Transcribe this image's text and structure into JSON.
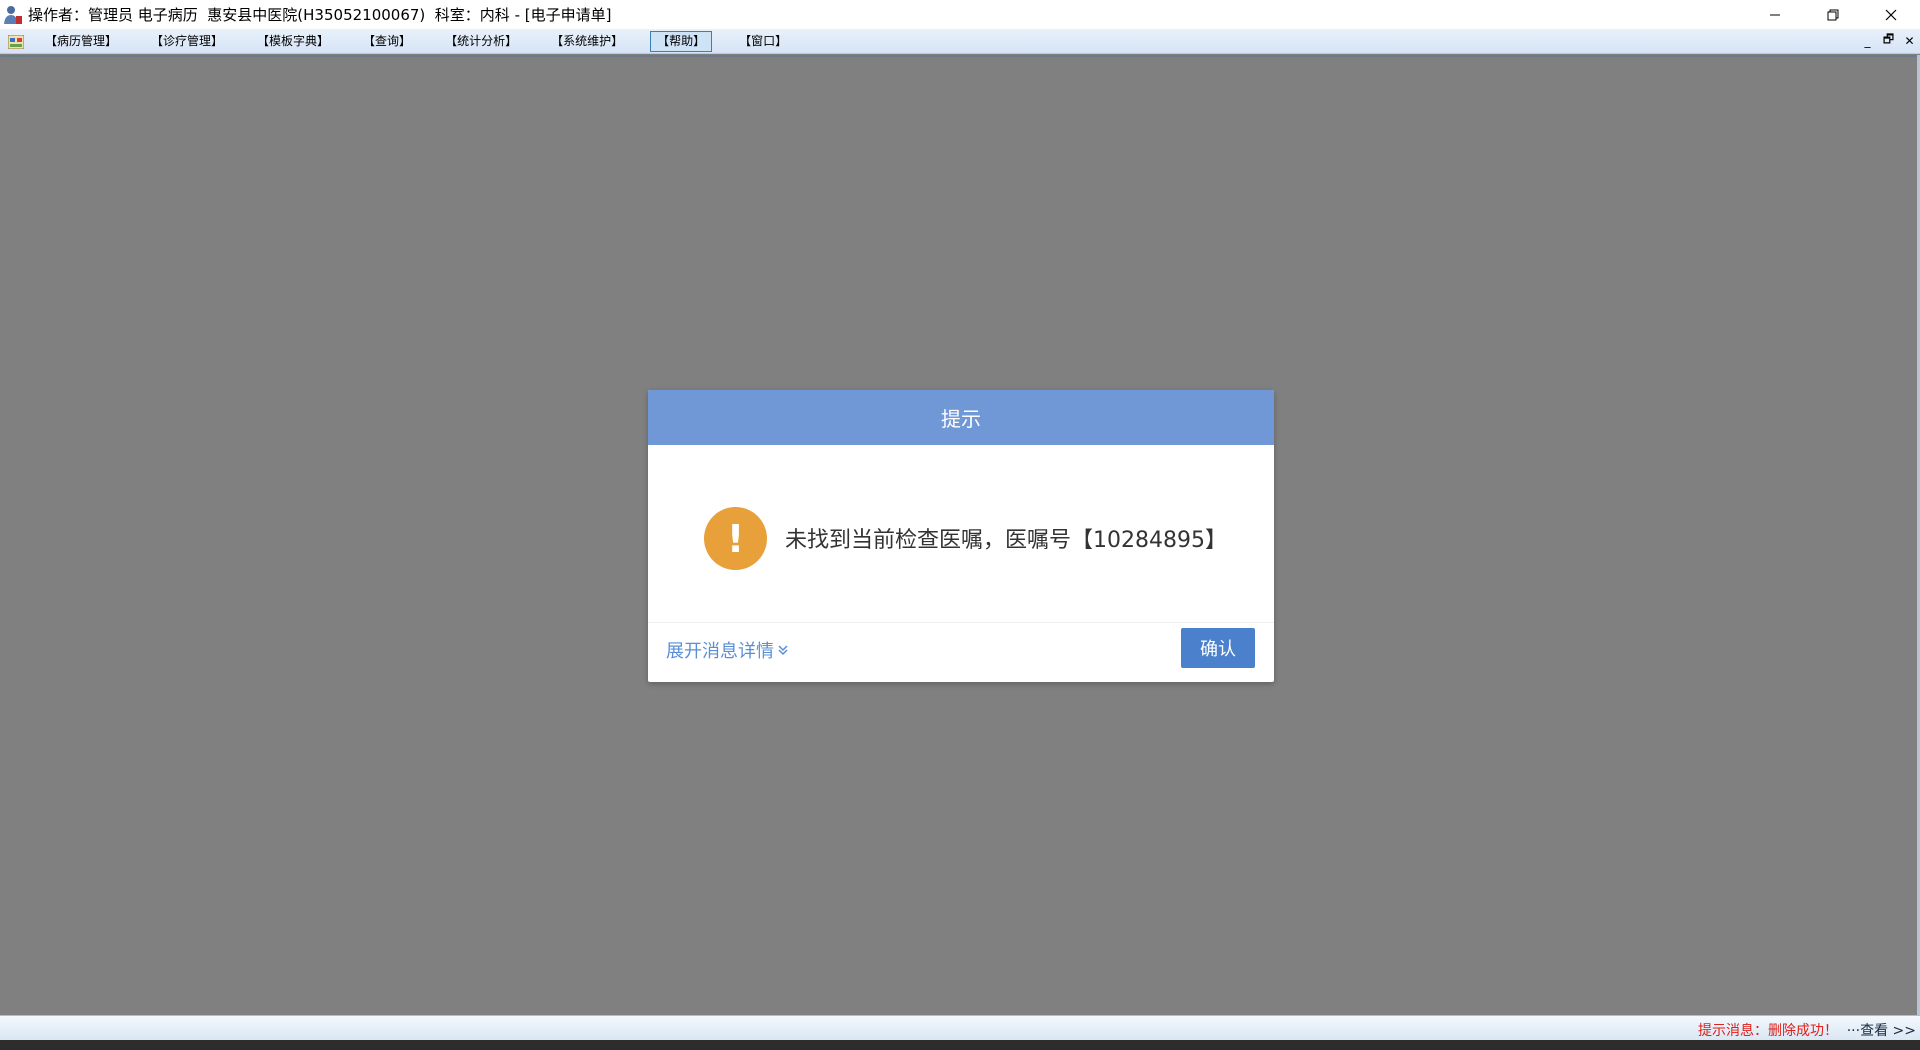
{
  "window": {
    "title": "操作者：管理员 电子病历  惠安县中医院(H35052100067)  科室：内科 - [电子申请单]",
    "icons": {
      "app": "doctor-app-icon",
      "minimize": "minimize-icon",
      "restore": "restore-icon",
      "close": "close-icon"
    }
  },
  "menu": {
    "items": [
      {
        "label": "【病历管理】"
      },
      {
        "label": "【诊疗管理】"
      },
      {
        "label": "【模板字典】"
      },
      {
        "label": "【查询】"
      },
      {
        "label": "【统计分析】"
      },
      {
        "label": "【系统维护】"
      },
      {
        "label": "【帮助】"
      },
      {
        "label": "【窗口】"
      }
    ],
    "active_index": 6,
    "mdi_controls": {
      "minimize": "_",
      "restore": "🗗",
      "close": "✕"
    }
  },
  "dialog": {
    "title": "提示",
    "icon": "warning-icon",
    "icon_glyph": "!",
    "message": "未找到当前检查医嘱，医嘱号【10284895】",
    "expand_label": "展开消息详情",
    "expand_icon": "double-chevron-down-icon",
    "confirm_label": "确认",
    "colors": {
      "header": "#7098d6",
      "warning": "#e8a03a",
      "button": "#4a80cc",
      "link": "#5b8fd4"
    }
  },
  "status": {
    "message": "提示消息：删除成功！",
    "view_label": "···查看 >>",
    "colors": {
      "message": "#e0201a"
    }
  }
}
